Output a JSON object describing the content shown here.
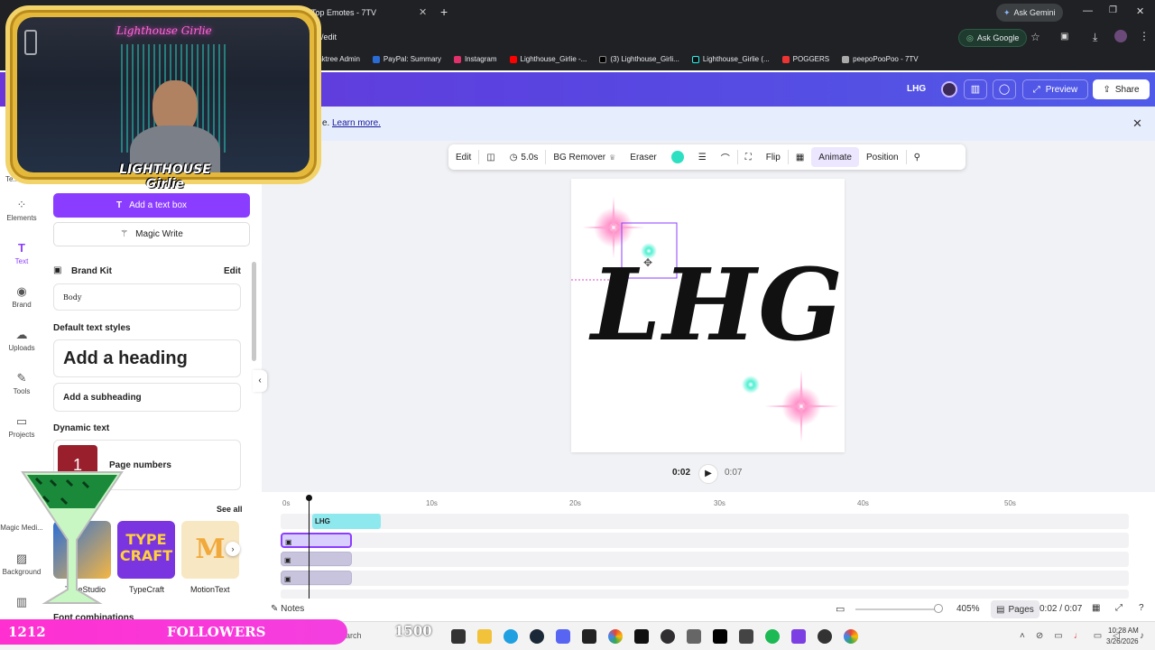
{
  "browser": {
    "tabs": [
      {
        "title": "Top Emotes - 7TV"
      }
    ],
    "url_fragment": "/edit",
    "ask_gemini": "Ask Gemini",
    "ask_google": "Ask Google",
    "bookmarks": [
      "Linktree Admin",
      "PayPal: Summary",
      "Instagram",
      "Lighthouse_Girlie -...",
      "(3) Lighthouse_Girli...",
      "Lighthouse_Girlie (...",
      "POGGERS",
      "peepoPooPoo - 7TV"
    ]
  },
  "canva_header": {
    "design_name": "LHG",
    "preview": "Preview",
    "share": "Share"
  },
  "banner": {
    "text_suffix": "e.",
    "link": "Learn more."
  },
  "toolbar": {
    "edit": "Edit",
    "duration": "5.0s",
    "bg_remover": "BG Remover",
    "eraser": "Eraser",
    "flip": "Flip",
    "animate": "Animate",
    "position": "Position",
    "color": "#2de0c2"
  },
  "rail": [
    {
      "label": "Te..."
    },
    {
      "label": "Elements"
    },
    {
      "label": "Text"
    },
    {
      "label": "Brand"
    },
    {
      "label": "Uploads"
    },
    {
      "label": "Tools"
    },
    {
      "label": "Projects"
    },
    {
      "label": "Magic Medi..."
    },
    {
      "label": "Background"
    }
  ],
  "panel": {
    "add_text_box": "Add a text box",
    "magic_write": "Magic Write",
    "brand_kit": "Brand Kit",
    "brand_kit_edit": "Edit",
    "body_label": "Body",
    "default_styles": "Default text styles",
    "heading": "Add a heading",
    "subheading": "Add a subheading",
    "dynamic_text": "Dynamic text",
    "page_numbers": "Page numbers",
    "see_all": "See all",
    "fonts": [
      "TypeStudio",
      "TypeCraft",
      "MotionText"
    ],
    "font_combinations": "Font combinations"
  },
  "artboard": {
    "text": "LHG"
  },
  "playback": {
    "current": "0:02",
    "total": "0:07"
  },
  "timeline": {
    "ticks": [
      "0s",
      "10s",
      "20s",
      "30s",
      "40s",
      "50s"
    ],
    "text_clip": "LHG"
  },
  "footer": {
    "notes": "Notes",
    "zoom": "405%",
    "pages": "Pages",
    "time": "0:02 / 0:07"
  },
  "stream_overlay": {
    "followers_count": "1212",
    "followers_label": "FOLLOWERS",
    "goal": "1500",
    "webcam_neon": "Lighthouse Girlie",
    "logo_text": "LIGHTHOUSE Girlie"
  },
  "taskbar": {
    "search": "Search",
    "time": "10:28 AM",
    "date": "3/26/2026"
  }
}
